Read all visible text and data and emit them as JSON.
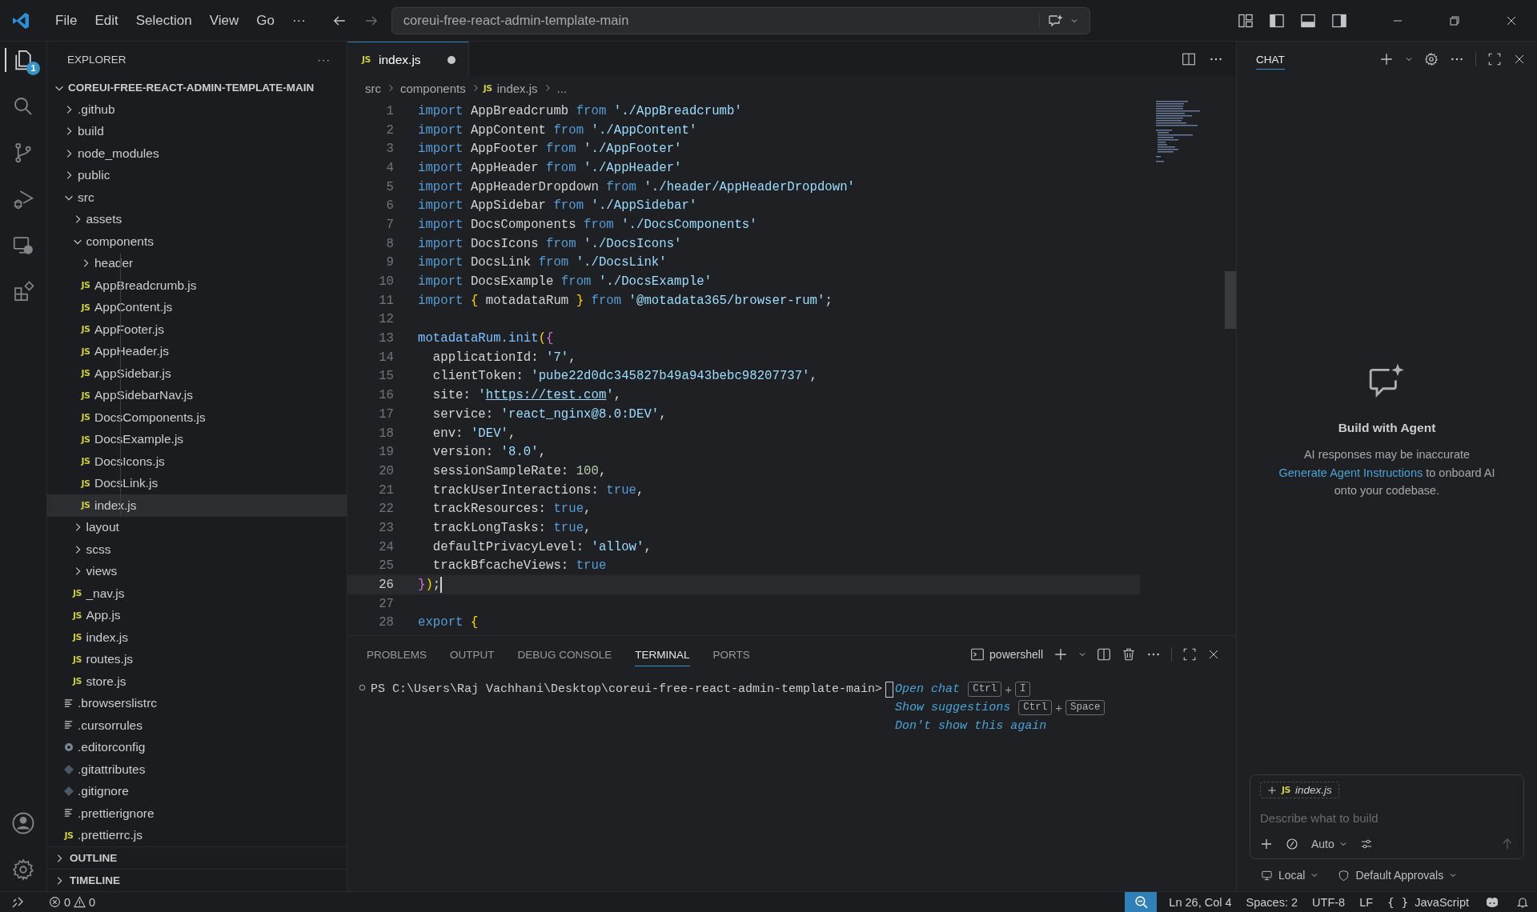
{
  "title_bar": {
    "menu": [
      "File",
      "Edit",
      "Selection",
      "View",
      "Go",
      "···"
    ],
    "search": "coreui-free-react-admin-template-main"
  },
  "activity_bar": {
    "badge": "1"
  },
  "explorer": {
    "title": "EXPLORER",
    "more": "···",
    "root": "COREUI-FREE-REACT-ADMIN-TEMPLATE-MAIN",
    "tree": [
      {
        "name": ".github",
        "kind": "folder",
        "expanded": false,
        "selected": false
      },
      {
        "name": "build",
        "kind": "folder",
        "expanded": false,
        "selected": false
      },
      {
        "name": "node_modules",
        "kind": "folder",
        "expanded": false,
        "selected": false
      },
      {
        "name": "public",
        "kind": "folder",
        "expanded": false,
        "selected": false
      },
      {
        "name": "src",
        "kind": "folder",
        "expanded": true,
        "selected": false,
        "children": [
          {
            "name": "assets",
            "kind": "folder",
            "expanded": false,
            "selected": false
          },
          {
            "name": "components",
            "kind": "folder",
            "expanded": true,
            "selected": false,
            "children": [
              {
                "name": "header",
                "kind": "folder",
                "expanded": false,
                "selected": false
              },
              {
                "name": "AppBreadcrumb.js",
                "kind": "js",
                "icon_text": "JS",
                "selected": false
              },
              {
                "name": "AppContent.js",
                "kind": "js",
                "icon_text": "JS",
                "selected": false
              },
              {
                "name": "AppFooter.js",
                "kind": "js",
                "icon_text": "JS",
                "selected": false
              },
              {
                "name": "AppHeader.js",
                "kind": "js",
                "icon_text": "JS",
                "selected": false
              },
              {
                "name": "AppSidebar.js",
                "kind": "js",
                "icon_text": "JS",
                "selected": false
              },
              {
                "name": "AppSidebarNav.js",
                "kind": "js",
                "icon_text": "JS",
                "selected": false
              },
              {
                "name": "DocsComponents.js",
                "kind": "js",
                "icon_text": "JS",
                "selected": false
              },
              {
                "name": "DocsExample.js",
                "kind": "js",
                "icon_text": "JS",
                "selected": false
              },
              {
                "name": "DocsIcons.js",
                "kind": "js",
                "icon_text": "JS",
                "selected": false
              },
              {
                "name": "DocsLink.js",
                "kind": "js",
                "icon_text": "JS",
                "selected": false
              },
              {
                "name": "index.js",
                "kind": "js",
                "icon_text": "JS",
                "selected": true
              }
            ]
          },
          {
            "name": "layout",
            "kind": "folder",
            "expanded": false,
            "selected": false
          },
          {
            "name": "scss",
            "kind": "folder",
            "expanded": false,
            "selected": false
          },
          {
            "name": "views",
            "kind": "folder",
            "expanded": false,
            "selected": false
          },
          {
            "name": "_nav.js",
            "kind": "js",
            "icon_text": "JS",
            "selected": false
          },
          {
            "name": "App.js",
            "kind": "js",
            "icon_text": "JS",
            "selected": false
          },
          {
            "name": "index.js",
            "kind": "js",
            "icon_text": "JS",
            "selected": false
          },
          {
            "name": "routes.js",
            "kind": "js",
            "icon_text": "JS",
            "selected": false
          },
          {
            "name": "store.js",
            "kind": "js",
            "icon_text": "JS",
            "selected": false
          }
        ]
      },
      {
        "name": ".browserslistrc",
        "kind": "text",
        "selected": false
      },
      {
        "name": ".cursorrules",
        "kind": "text",
        "selected": false
      },
      {
        "name": ".editorconfig",
        "kind": "config",
        "selected": false
      },
      {
        "name": ".gitattributes",
        "kind": "git",
        "selected": false
      },
      {
        "name": ".gitignore",
        "kind": "git",
        "selected": false
      },
      {
        "name": ".prettierignore",
        "kind": "text",
        "selected": false
      },
      {
        "name": ".prettierrc.js",
        "kind": "js",
        "icon_text": "JS",
        "selected": false
      }
    ],
    "sections": [
      {
        "label": "OUTLINE",
        "expanded": false
      },
      {
        "label": "TIMELINE",
        "expanded": false
      }
    ]
  },
  "editor": {
    "tabs": [
      {
        "label": "index.js",
        "icon_text": "JS",
        "selected": true,
        "modified": true
      }
    ],
    "breadcrumb": [
      {
        "t": "src",
        "kind": "folder"
      },
      {
        "t": "components",
        "kind": "folder"
      },
      {
        "t": "index.js",
        "kind": "js",
        "icon_text": "JS"
      },
      {
        "t": "...",
        "kind": "more"
      }
    ],
    "lines": [
      {
        "n": "1",
        "active": false,
        "tokens": [
          {
            "t": "import",
            "kind": "kw"
          },
          {
            "t": " AppBreadcrumb ",
            "kind": "id"
          },
          {
            "t": "from",
            "kind": "kw"
          },
          {
            "t": " './AppBreadcrumb'",
            "kind": "str"
          }
        ]
      },
      {
        "n": "2",
        "active": false,
        "tokens": [
          {
            "t": "import",
            "kind": "kw"
          },
          {
            "t": " AppContent ",
            "kind": "id"
          },
          {
            "t": "from",
            "kind": "kw"
          },
          {
            "t": " './AppContent'",
            "kind": "str"
          }
        ]
      },
      {
        "n": "3",
        "active": false,
        "tokens": [
          {
            "t": "import",
            "kind": "kw"
          },
          {
            "t": " AppFooter ",
            "kind": "id"
          },
          {
            "t": "from",
            "kind": "kw"
          },
          {
            "t": " './AppFooter'",
            "kind": "str"
          }
        ]
      },
      {
        "n": "4",
        "active": false,
        "tokens": [
          {
            "t": "import",
            "kind": "kw"
          },
          {
            "t": " AppHeader ",
            "kind": "id"
          },
          {
            "t": "from",
            "kind": "kw"
          },
          {
            "t": " './AppHeader'",
            "kind": "str"
          }
        ]
      },
      {
        "n": "5",
        "active": false,
        "tokens": [
          {
            "t": "import",
            "kind": "kw"
          },
          {
            "t": " AppHeaderDropdown ",
            "kind": "id"
          },
          {
            "t": "from",
            "kind": "kw"
          },
          {
            "t": " './header/AppHeaderDropdown'",
            "kind": "str"
          }
        ]
      },
      {
        "n": "6",
        "active": false,
        "tokens": [
          {
            "t": "import",
            "kind": "kw"
          },
          {
            "t": " AppSidebar ",
            "kind": "id"
          },
          {
            "t": "from",
            "kind": "kw"
          },
          {
            "t": " './AppSidebar'",
            "kind": "str"
          }
        ]
      },
      {
        "n": "7",
        "active": false,
        "tokens": [
          {
            "t": "import",
            "kind": "kw"
          },
          {
            "t": " DocsComponents ",
            "kind": "id"
          },
          {
            "t": "from",
            "kind": "kw"
          },
          {
            "t": " './DocsComponents'",
            "kind": "str"
          }
        ]
      },
      {
        "n": "8",
        "active": false,
        "tokens": [
          {
            "t": "import",
            "kind": "kw"
          },
          {
            "t": " DocsIcons ",
            "kind": "id"
          },
          {
            "t": "from",
            "kind": "kw"
          },
          {
            "t": " './DocsIcons'",
            "kind": "str"
          }
        ]
      },
      {
        "n": "9",
        "active": false,
        "tokens": [
          {
            "t": "import",
            "kind": "kw"
          },
          {
            "t": " DocsLink ",
            "kind": "id"
          },
          {
            "t": "from",
            "kind": "kw"
          },
          {
            "t": " './DocsLink'",
            "kind": "str"
          }
        ]
      },
      {
        "n": "10",
        "active": false,
        "tokens": [
          {
            "t": "import",
            "kind": "kw"
          },
          {
            "t": " DocsExample ",
            "kind": "id"
          },
          {
            "t": "from",
            "kind": "kw"
          },
          {
            "t": " './DocsExample'",
            "kind": "str"
          }
        ]
      },
      {
        "n": "11",
        "active": false,
        "tokens": [
          {
            "t": "import",
            "kind": "kw"
          },
          {
            "t": " {",
            "kind": "brace"
          },
          {
            "t": " motadataRum ",
            "kind": "id"
          },
          {
            "t": "}",
            "kind": "brace"
          },
          {
            "t": " from",
            "kind": "kw"
          },
          {
            "t": " '@motadata365/browser-rum'",
            "kind": "str"
          },
          {
            "t": ";",
            "kind": "id"
          }
        ]
      },
      {
        "n": "12",
        "active": false
      },
      {
        "n": "13",
        "active": false,
        "tokens": [
          {
            "t": "motadataRum.init",
            "kind": "fn"
          },
          {
            "t": "(",
            "kind": "brace"
          },
          {
            "t": "{",
            "kind": "paren"
          }
        ]
      },
      {
        "n": "14",
        "active": false,
        "tokens": [
          {
            "t": "  applicationId: ",
            "kind": "id"
          },
          {
            "t": "'7'",
            "kind": "str"
          },
          {
            "t": ",",
            "kind": "id"
          }
        ]
      },
      {
        "n": "15",
        "active": false,
        "tokens": [
          {
            "t": "  clientToken: ",
            "kind": "id"
          },
          {
            "t": "'pube22d0dc345827b49a943bebc98207737'",
            "kind": "str"
          },
          {
            "t": ",",
            "kind": "id"
          }
        ]
      },
      {
        "n": "16",
        "active": false,
        "tokens": [
          {
            "t": "  site: ",
            "kind": "id"
          },
          {
            "t": "'",
            "kind": "str"
          },
          {
            "t": "https://test.com",
            "kind": "link"
          },
          {
            "t": "'",
            "kind": "str"
          },
          {
            "t": ",",
            "kind": "id"
          }
        ]
      },
      {
        "n": "17",
        "active": false,
        "tokens": [
          {
            "t": "  service: ",
            "kind": "id"
          },
          {
            "t": "'react_nginx@8.0:DEV'",
            "kind": "str"
          },
          {
            "t": ",",
            "kind": "id"
          }
        ]
      },
      {
        "n": "18",
        "active": false,
        "tokens": [
          {
            "t": "  env: ",
            "kind": "id"
          },
          {
            "t": "'DEV'",
            "kind": "str"
          },
          {
            "t": ",",
            "kind": "id"
          }
        ]
      },
      {
        "n": "19",
        "active": false,
        "tokens": [
          {
            "t": "  version: ",
            "kind": "id"
          },
          {
            "t": "'8.0'",
            "kind": "str"
          },
          {
            "t": ",",
            "kind": "id"
          }
        ]
      },
      {
        "n": "20",
        "active": false,
        "tokens": [
          {
            "t": "  sessionSampleRate: ",
            "kind": "id"
          },
          {
            "t": "100",
            "kind": "num"
          },
          {
            "t": ",",
            "kind": "id"
          }
        ]
      },
      {
        "n": "21",
        "active": false,
        "tokens": [
          {
            "t": "  trackUserInteractions: ",
            "kind": "id"
          },
          {
            "t": "true",
            "kind": "bool"
          },
          {
            "t": ",",
            "kind": "id"
          }
        ]
      },
      {
        "n": "22",
        "active": false,
        "tokens": [
          {
            "t": "  trackResources: ",
            "kind": "id"
          },
          {
            "t": "true",
            "kind": "bool"
          },
          {
            "t": ",",
            "kind": "id"
          }
        ]
      },
      {
        "n": "23",
        "active": false,
        "tokens": [
          {
            "t": "  trackLongTasks: ",
            "kind": "id"
          },
          {
            "t": "true",
            "kind": "bool"
          },
          {
            "t": ",",
            "kind": "id"
          }
        ]
      },
      {
        "n": "24",
        "active": false,
        "tokens": [
          {
            "t": "  defaultPrivacyLevel: ",
            "kind": "id"
          },
          {
            "t": "'allow'",
            "kind": "str"
          },
          {
            "t": ",",
            "kind": "id"
          }
        ]
      },
      {
        "n": "25",
        "active": false,
        "tokens": [
          {
            "t": "  trackBfcacheViews: ",
            "kind": "id"
          },
          {
            "t": "true",
            "kind": "bool"
          }
        ]
      },
      {
        "n": "26",
        "active": true,
        "tokens": [
          {
            "t": "}",
            "kind": "paren"
          },
          {
            "t": ")",
            "kind": "brace"
          },
          {
            "t": ";",
            "kind": "id"
          }
        ]
      },
      {
        "n": "27",
        "active": false
      },
      {
        "n": "28",
        "active": false,
        "tokens": [
          {
            "t": "export",
            "kind": "kw"
          },
          {
            "t": " {",
            "kind": "brace"
          }
        ]
      }
    ]
  },
  "panel": {
    "tabs": [
      {
        "label": "PROBLEMS",
        "selected": false
      },
      {
        "label": "OUTPUT",
        "selected": false
      },
      {
        "label": "DEBUG CONSOLE",
        "selected": false
      },
      {
        "label": "TERMINAL",
        "selected": true
      },
      {
        "label": "PORTS",
        "selected": false
      }
    ],
    "terminal_name": "powershell",
    "prompt": "PS C:\\Users\\Raj Vachhani\\Desktop\\coreui-free-react-admin-template-main>",
    "hints": [
      {
        "text": "Open chat",
        "keys": [
          {
            "t": "Ctrl",
            "kind": "key"
          },
          {
            "t": "+",
            "kind": "plus"
          },
          {
            "t": "I",
            "kind": "key"
          }
        ]
      },
      {
        "text": "Show suggestions",
        "keys": [
          {
            "t": "Ctrl",
            "kind": "key"
          },
          {
            "t": "+",
            "kind": "plus"
          },
          {
            "t": "Space",
            "kind": "key"
          }
        ]
      },
      {
        "text": "Don't show this again"
      }
    ]
  },
  "chat": {
    "title": "CHAT",
    "heading": "Build with Agent",
    "note": "AI responses may be inaccurate",
    "link": "Generate Agent Instructions",
    "link_tail": " to onboard AI onto your codebase.",
    "attachment": {
      "label": "index.js",
      "icon_text": "JS"
    },
    "placeholder": "Describe what to build",
    "mode": "Auto",
    "location": "Local",
    "approvals": "Default Approvals"
  },
  "status_bar": {
    "errors": "0",
    "warnings": "0",
    "position": "Ln 26, Col 4",
    "spaces": "Spaces: 2",
    "encoding": "UTF-8",
    "eol": "LF",
    "language_icon": "{ }",
    "language": "JavaScript"
  }
}
